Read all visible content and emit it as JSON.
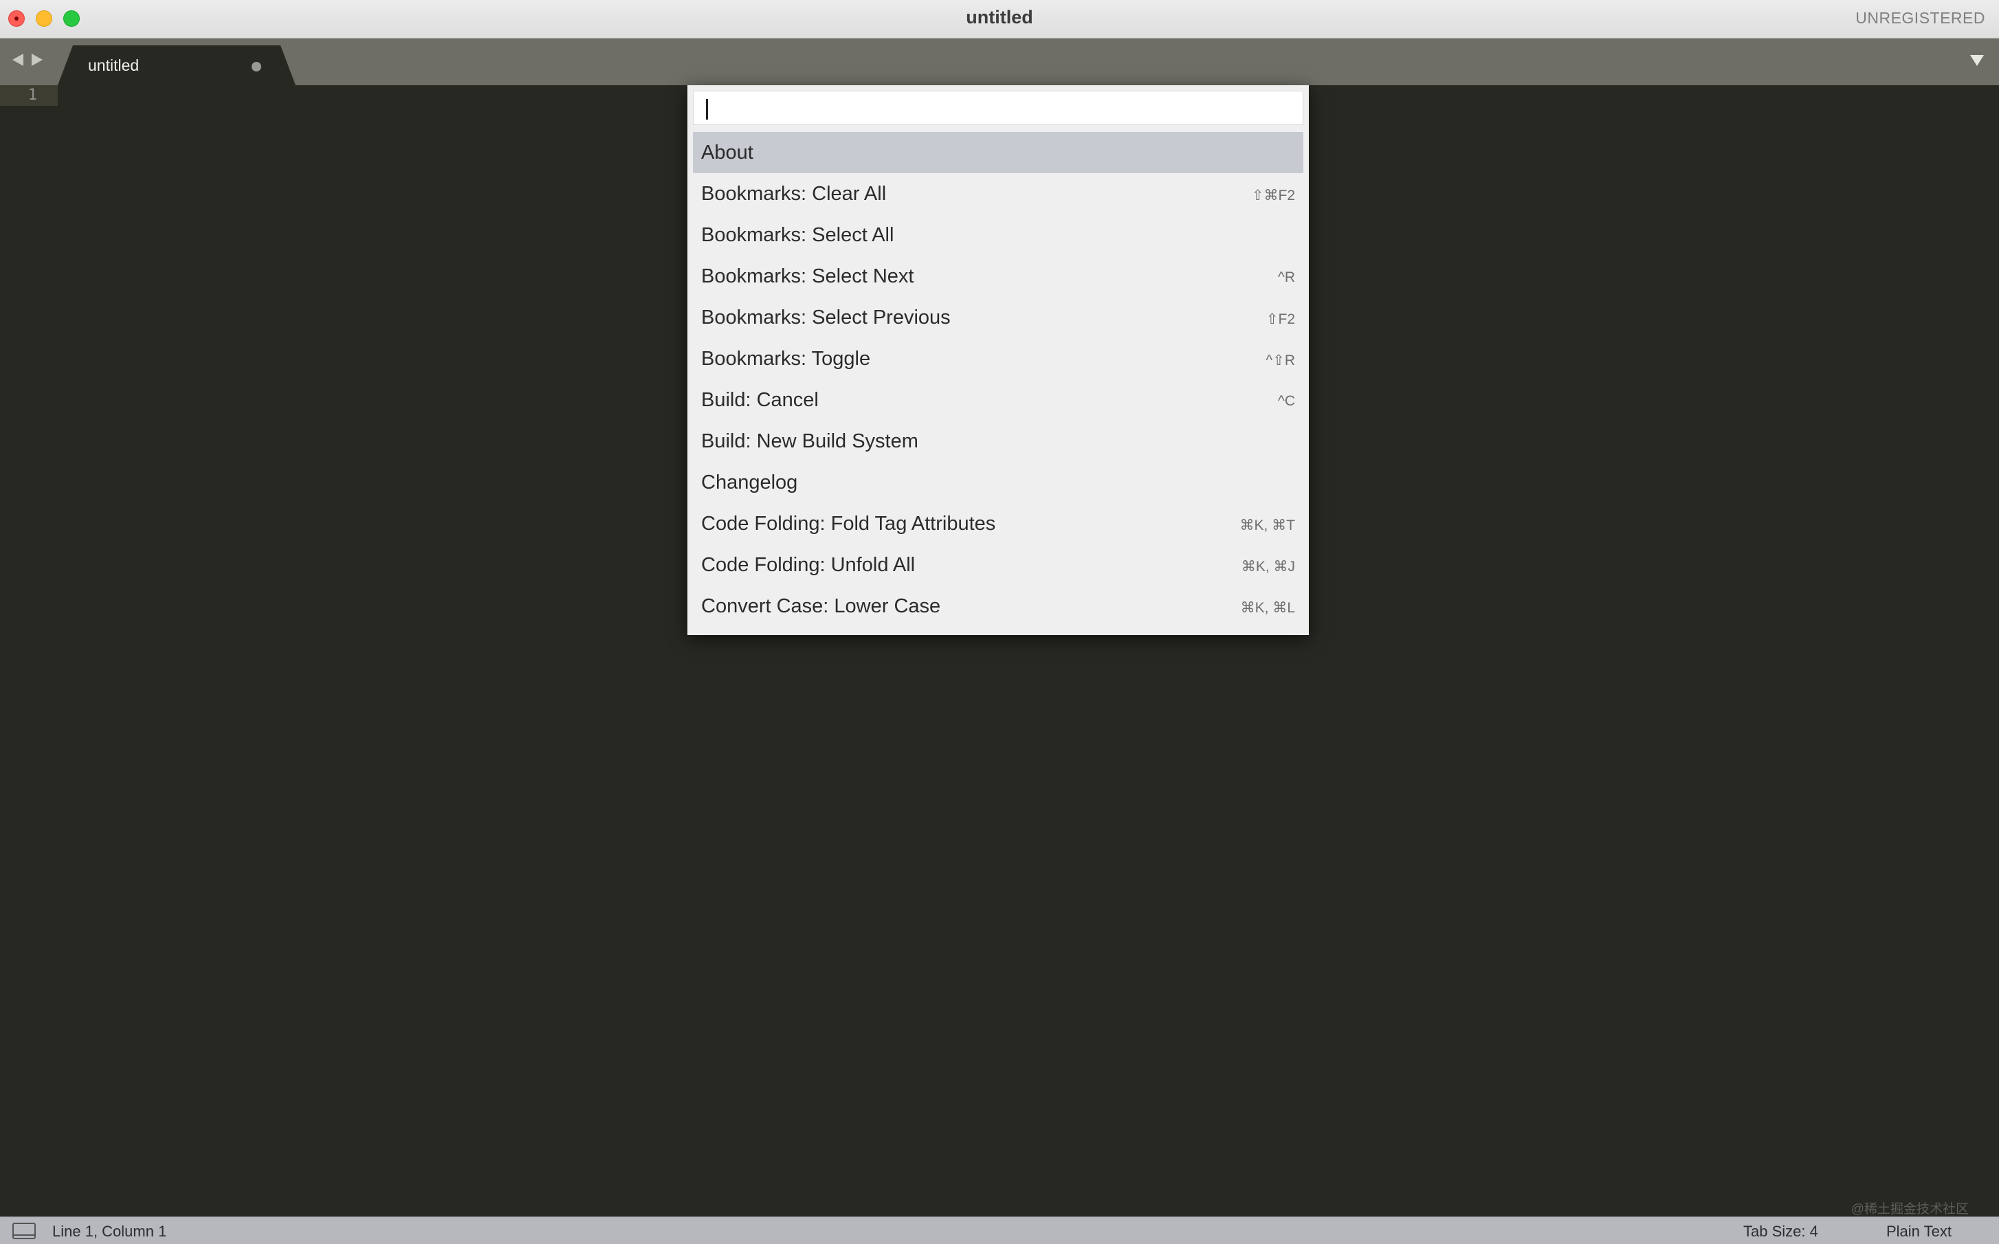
{
  "window": {
    "title": "untitled",
    "registration": "UNREGISTERED"
  },
  "tabs": [
    {
      "label": "untitled",
      "dirty": true
    }
  ],
  "editor": {
    "line_numbers": [
      "1"
    ]
  },
  "palette": {
    "query": "",
    "items": [
      {
        "label": "About",
        "shortcut": "",
        "selected": true
      },
      {
        "label": "Bookmarks: Clear All",
        "shortcut": "⇧⌘F2"
      },
      {
        "label": "Bookmarks: Select All",
        "shortcut": ""
      },
      {
        "label": "Bookmarks: Select Next",
        "shortcut": "^R"
      },
      {
        "label": "Bookmarks: Select Previous",
        "shortcut": "⇧F2"
      },
      {
        "label": "Bookmarks: Toggle",
        "shortcut": "^⇧R"
      },
      {
        "label": "Build: Cancel",
        "shortcut": "^C"
      },
      {
        "label": "Build: New Build System",
        "shortcut": ""
      },
      {
        "label": "Changelog",
        "shortcut": ""
      },
      {
        "label": "Code Folding: Fold Tag Attributes",
        "shortcut": "⌘K, ⌘T"
      },
      {
        "label": "Code Folding: Unfold All",
        "shortcut": "⌘K, ⌘J"
      },
      {
        "label": "Convert Case: Lower Case",
        "shortcut": "⌘K, ⌘L"
      }
    ]
  },
  "statusbar": {
    "position": "Line 1, Column 1",
    "tab_size": "Tab Size: 4",
    "syntax": "Plain Text"
  },
  "watermark": "@稀土掘金技术社区"
}
